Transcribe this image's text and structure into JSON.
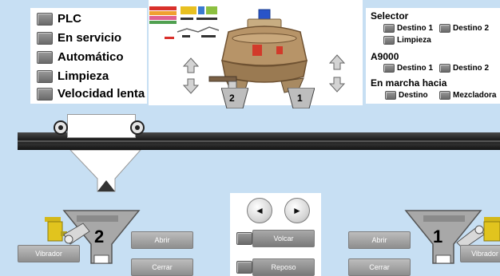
{
  "status_panel": {
    "items": [
      {
        "label": "PLC"
      },
      {
        "label": "En servicio"
      },
      {
        "label": "Automático"
      },
      {
        "label": "Limpieza"
      },
      {
        "label": "Velocidad lenta"
      }
    ]
  },
  "mixer": {
    "outlet_left": "2",
    "outlet_right": "1"
  },
  "right_panel": {
    "selector": {
      "title": "Selector",
      "destino1": "Destino 1",
      "destino2": "Destino 2",
      "limpieza": "Limpieza"
    },
    "a9000": {
      "title": "A9000",
      "destino1": "Destino 1",
      "destino2": "Destino 2"
    },
    "en_marcha": {
      "title": "En marcha hacia",
      "destino": "Destino",
      "mezcladora": "Mezcladora"
    }
  },
  "left_hopper": {
    "number": "2",
    "vibrador": "Vibrador",
    "abrir": "Abrir",
    "cerrar": "Cerrar"
  },
  "right_hopper": {
    "number": "1",
    "vibrador": "Vibrador",
    "abrir": "Abrir",
    "cerrar": "Cerrar"
  },
  "center_controls": {
    "prev_icon": "◄",
    "next_icon": "►",
    "volcar": "Volcar",
    "reposo": "Reposo"
  },
  "colors": {
    "background": "#c7dff3",
    "panel": "#ffffff",
    "rail": "#2b2b2b",
    "indicator": "#7a7a7a",
    "button": "#a0a0a0",
    "mixer_body": "#b79468"
  }
}
